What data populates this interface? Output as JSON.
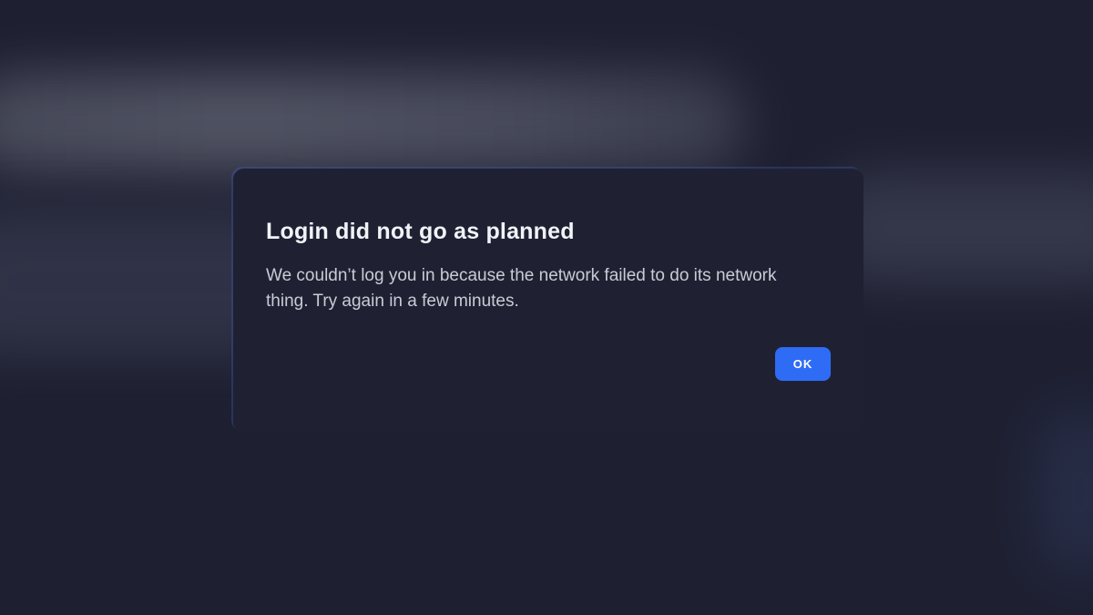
{
  "dialog": {
    "title": "Login did not go as planned",
    "message": "We couldn’t log you in because the network failed to do its network thing. Try again in a few minutes.",
    "ok_label": "OK"
  },
  "colors": {
    "background": "#1e2032",
    "dialog_background": "#1f2133",
    "accent": "#2f6cf6",
    "title_text": "#f2f3f7",
    "body_text": "#c9cbd4"
  }
}
